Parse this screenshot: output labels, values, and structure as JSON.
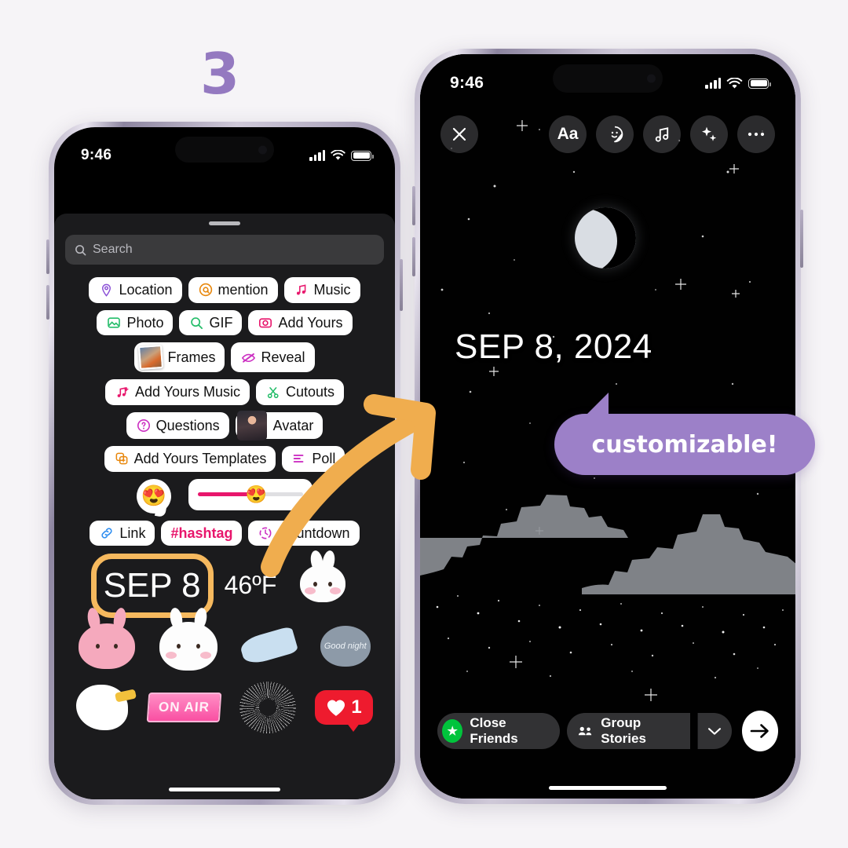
{
  "meta": {
    "step_number": "3",
    "background": "#f6f4f7",
    "accent_purple": "#9c80c8",
    "accent_orange": "#f6b95e"
  },
  "callout": {
    "text": "customizable!"
  },
  "left_phone": {
    "status": {
      "time": "9:46",
      "signal_icon": "cellular-bars-icon",
      "wifi_icon": "wifi-icon",
      "battery_icon": "battery-icon"
    },
    "search": {
      "placeholder": "Search",
      "icon": "search-icon"
    },
    "sticker_rows": [
      [
        {
          "label": "Location",
          "icon": "location-pin-icon",
          "color": "#8a4fd6"
        },
        {
          "label": "mention",
          "icon": "at-mention-icon",
          "color": "#e8870c"
        },
        {
          "label": "Music",
          "icon": "music-note-icon",
          "color": "#e8166c"
        }
      ],
      [
        {
          "label": "Photo",
          "icon": "photo-icon",
          "color": "#25bd6a"
        },
        {
          "label": "GIF",
          "icon": "gif-search-icon",
          "color": "#25bd6a"
        },
        {
          "label": "Add Yours",
          "icon": "camera-icon",
          "color": "#e8166c"
        }
      ],
      [
        {
          "label": "Frames",
          "icon": "polaroid-frame-icon",
          "color": "#ffffff"
        },
        {
          "label": "Reveal",
          "icon": "eye-slash-icon",
          "color": "#cc2fc2"
        }
      ],
      [
        {
          "label": "Add Yours Music",
          "icon": "music-plus-icon",
          "color": "#e8166c"
        },
        {
          "label": "Cutouts",
          "icon": "scissors-icon",
          "color": "#25bd6a"
        }
      ],
      [
        {
          "label": "Questions",
          "icon": "question-mark-icon",
          "color": "#cc2fc2"
        },
        {
          "label": "Avatar",
          "icon": "avatar-photo-icon",
          "color": "#ffffff"
        }
      ],
      [
        {
          "label": "Add Yours Templates",
          "icon": "templates-icon",
          "color": "#e8870c"
        },
        {
          "label": "Poll",
          "icon": "poll-bars-icon",
          "color": "#cc2fc2"
        }
      ],
      [
        {
          "label": "Link",
          "icon": "link-icon",
          "color": "#2d8df0"
        },
        {
          "label": "#hashtag",
          "icon": "hashtag-icon",
          "color": "#e8166c"
        },
        {
          "label": "Countdown",
          "icon": "countdown-clock-icon",
          "color": "#cc2fc2"
        }
      ]
    ],
    "emoji_stickers": {
      "emoji_slider_face": "😍",
      "emoji_bubble_face": "😍"
    },
    "date_sticker": {
      "text": "SEP 8",
      "highlighted": true
    },
    "temperature_sticker": {
      "text": "46ºF"
    },
    "cute_stickers": [
      {
        "name": "pun-pun-chef-bunny"
      },
      {
        "name": "pink-bunny-sweat"
      },
      {
        "name": "white-bunny-crying"
      },
      {
        "name": "bunny-on-spoon"
      },
      {
        "name": "good-night-balloon-bunny"
      },
      {
        "name": "duck-with-cup"
      },
      {
        "name": "on-air-sign",
        "label": "ON AIR"
      },
      {
        "name": "sparkle-burst"
      },
      {
        "name": "like-count-bubble",
        "label": "1"
      }
    ]
  },
  "right_phone": {
    "status": {
      "time": "9:46",
      "signal_icon": "cellular-bars-icon",
      "wifi_icon": "wifi-icon",
      "battery_icon": "battery-icon"
    },
    "toolbar": {
      "close_label": "✕",
      "text_label": "Aa",
      "sticker_icon": "sticker-smiley-icon",
      "music_icon": "music-note-icon",
      "effects_icon": "sparkles-icon",
      "more_icon": "more-dots-icon"
    },
    "canvas": {
      "date_text": "SEP 8, 2024",
      "scene": "night-sky-crescent-moon-city-skyline"
    },
    "bottom_bar": {
      "close_friends_label": "Close Friends",
      "close_friends_icon": "green-star-icon",
      "group_stories_label": "Group Stories",
      "group_stories_icon": "people-group-icon",
      "chevron_icon": "chevron-down-icon",
      "send_icon": "arrow-right-icon"
    }
  }
}
